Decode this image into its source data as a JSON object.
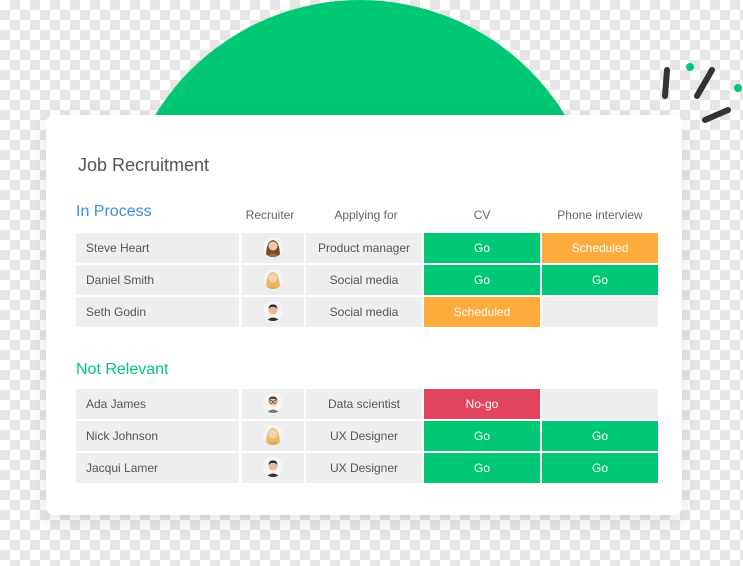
{
  "title": "Job Recruitment",
  "columns": {
    "recruiter": "Recruiter",
    "applying_for": "Applying for",
    "cv": "CV",
    "phone": "Phone interview"
  },
  "colors": {
    "go": "#00c875",
    "scheduled": "#fdab3d",
    "nogo": "#e2445c",
    "empty": "#eeeeee",
    "in_process": "#3e8edf",
    "not_relevant": "#00c875"
  },
  "groups": [
    {
      "name": "In Process",
      "rows": [
        {
          "name": "Steve Heart",
          "recruiter_icon": "woman-brown-hair-avatar",
          "applying": "Product manager",
          "cv": "Go",
          "phone": "Scheduled"
        },
        {
          "name": "Daniel Smith",
          "recruiter_icon": "woman-blonde-avatar",
          "applying": "Social media",
          "cv": "Go",
          "phone": "Go"
        },
        {
          "name": "Seth Godin",
          "recruiter_icon": "man-dark-hair-avatar",
          "applying": "Social media",
          "cv": "Scheduled",
          "phone": ""
        }
      ]
    },
    {
      "name": "Not Relevant",
      "rows": [
        {
          "name": "Ada James",
          "recruiter_icon": "man-glasses-avatar",
          "applying": "Data scientist",
          "cv": "No-go",
          "phone": ""
        },
        {
          "name": "Nick Johnson",
          "recruiter_icon": "woman-blonde-avatar",
          "applying": "UX Designer",
          "cv": "Go",
          "phone": "Go"
        },
        {
          "name": "Jacqui Lamer",
          "recruiter_icon": "man-dark-hair-avatar",
          "applying": "UX Designer",
          "cv": "Go",
          "phone": "Go"
        }
      ]
    }
  ]
}
